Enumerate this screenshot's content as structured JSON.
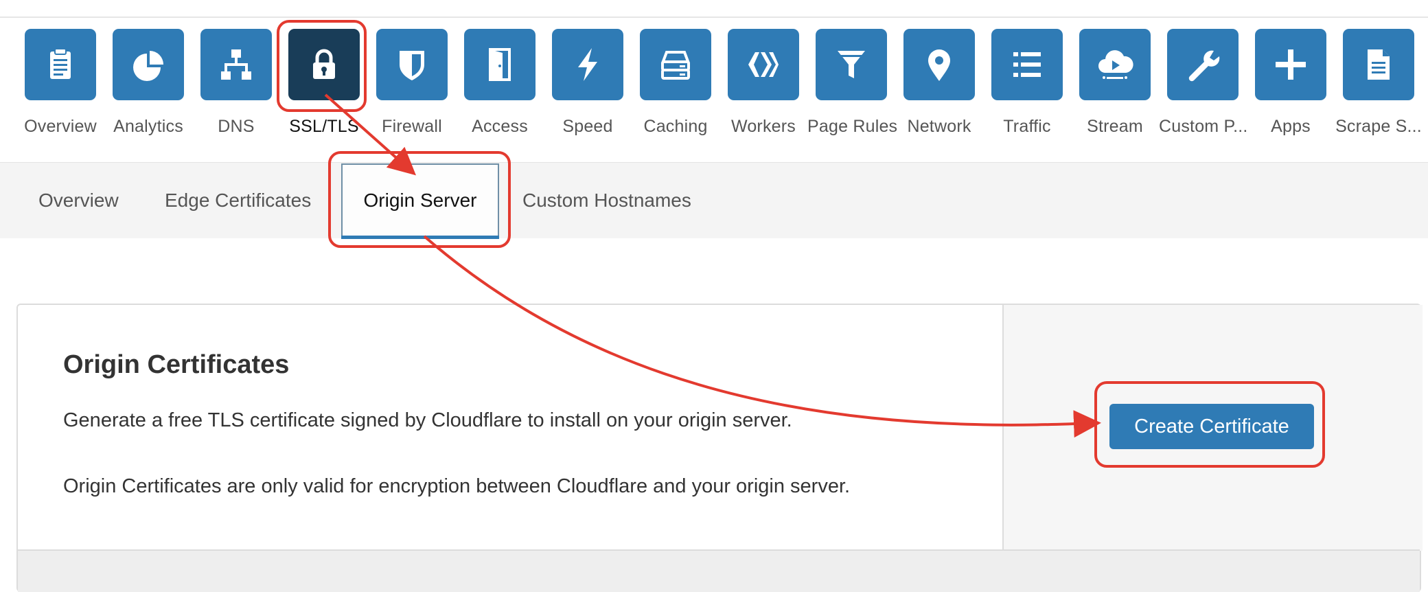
{
  "apps": [
    {
      "label": "Overview",
      "icon": "clipboard-icon"
    },
    {
      "label": "Analytics",
      "icon": "pie-chart-icon"
    },
    {
      "label": "DNS",
      "icon": "sitemap-icon"
    },
    {
      "label": "SSL/TLS",
      "icon": "lock-icon"
    },
    {
      "label": "Firewall",
      "icon": "shield-icon"
    },
    {
      "label": "Access",
      "icon": "door-icon"
    },
    {
      "label": "Speed",
      "icon": "lightning-icon"
    },
    {
      "label": "Caching",
      "icon": "server-icon"
    },
    {
      "label": "Workers",
      "icon": "workers-icon"
    },
    {
      "label": "Page Rules",
      "icon": "filter-icon"
    },
    {
      "label": "Network",
      "icon": "map-pin-icon"
    },
    {
      "label": "Traffic",
      "icon": "list-icon"
    },
    {
      "label": "Stream",
      "icon": "cloud-play-icon"
    },
    {
      "label": "Custom P...",
      "icon": "wrench-icon"
    },
    {
      "label": "Apps",
      "icon": "plus-icon"
    },
    {
      "label": "Scrape S...",
      "icon": "document-icon"
    }
  ],
  "active_app": "SSL/TLS",
  "subnav": {
    "tabs": [
      "Overview",
      "Edge Certificates",
      "Origin Server",
      "Custom Hostnames"
    ],
    "active": "Origin Server"
  },
  "card": {
    "title": "Origin Certificates",
    "desc1": "Generate a free TLS certificate signed by Cloudflare to install on your origin server.",
    "desc2": "Origin Certificates are only valid for encryption between Cloudflare and your origin server.",
    "button": "Create Certificate"
  },
  "colors": {
    "tile": "#2f7bb5",
    "tile_active": "#193d58",
    "annotation": "#e33a2f",
    "button": "#2f7bb5"
  }
}
